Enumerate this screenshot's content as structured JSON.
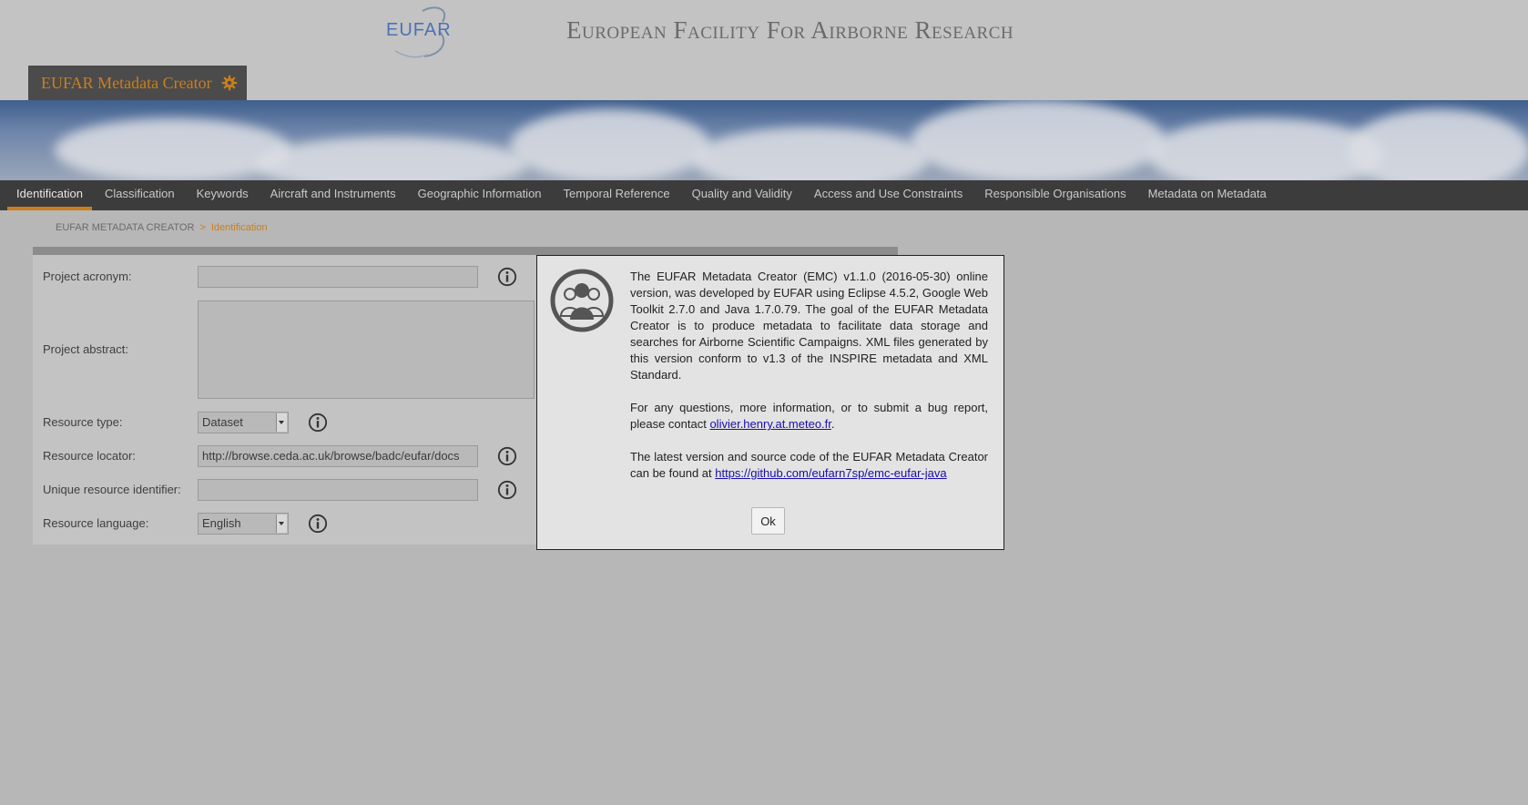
{
  "header": {
    "logo_text": "EUFAR",
    "site_title": "European Facility For Airborne Research",
    "app_tab_label": "EUFAR Metadata Creator",
    "app_tab_icon": "gear-icon"
  },
  "nav": {
    "items": [
      {
        "label": "Identification",
        "active": true
      },
      {
        "label": "Classification"
      },
      {
        "label": "Keywords"
      },
      {
        "label": "Aircraft and Instruments"
      },
      {
        "label": "Geographic Information"
      },
      {
        "label": "Temporal Reference"
      },
      {
        "label": "Quality and Validity"
      },
      {
        "label": "Access and Use Constraints"
      },
      {
        "label": "Responsible Organisations"
      },
      {
        "label": "Metadata on Metadata"
      }
    ]
  },
  "breadcrumb": {
    "root": "EUFAR METADATA CREATOR",
    "separator": ">",
    "current": "Identification"
  },
  "form": {
    "project_acronym": {
      "label": "Project acronym:",
      "value": ""
    },
    "project_abstract": {
      "label": "Project abstract:",
      "value": ""
    },
    "resource_type": {
      "label": "Resource type:",
      "value": "Dataset"
    },
    "resource_locator": {
      "label": "Resource locator:",
      "value": "http://browse.ceda.ac.uk/browse/badc/eufar/docs"
    },
    "unique_resource_identifier": {
      "label": "Unique resource identifier:",
      "value": ""
    },
    "resource_language": {
      "label": "Resource language:",
      "value": "English"
    }
  },
  "dialog": {
    "para1": "The EUFAR Metadata Creator (EMC) v1.1.0 (2016-05-30) online version, was developed by EUFAR using Eclipse 4.5.2, Google Web Toolkit 2.7.0 and Java 1.7.0.79. The goal of the EUFAR Metadata Creator is to produce metadata to facilitate data storage and searches for Airborne Scientific Campaigns. XML files generated by this version conform to v1.3 of the INSPIRE metadata and XML Standard.",
    "para2_prefix": "For any questions, more information, or to submit a bug report, please contact ",
    "contact_link": "olivier.henry.at.meteo.fr",
    "para2_suffix": ".",
    "para3_prefix": "The latest version and source code of the EUFAR Metadata Creator can be found at ",
    "source_link": "https://github.com/eufarn7sp/emc-eufar-java",
    "ok_label": "Ok"
  },
  "colors": {
    "accent": "#c97f1d",
    "nav_bg": "#3c3c3c",
    "page_bg": "#b7b7b7"
  }
}
